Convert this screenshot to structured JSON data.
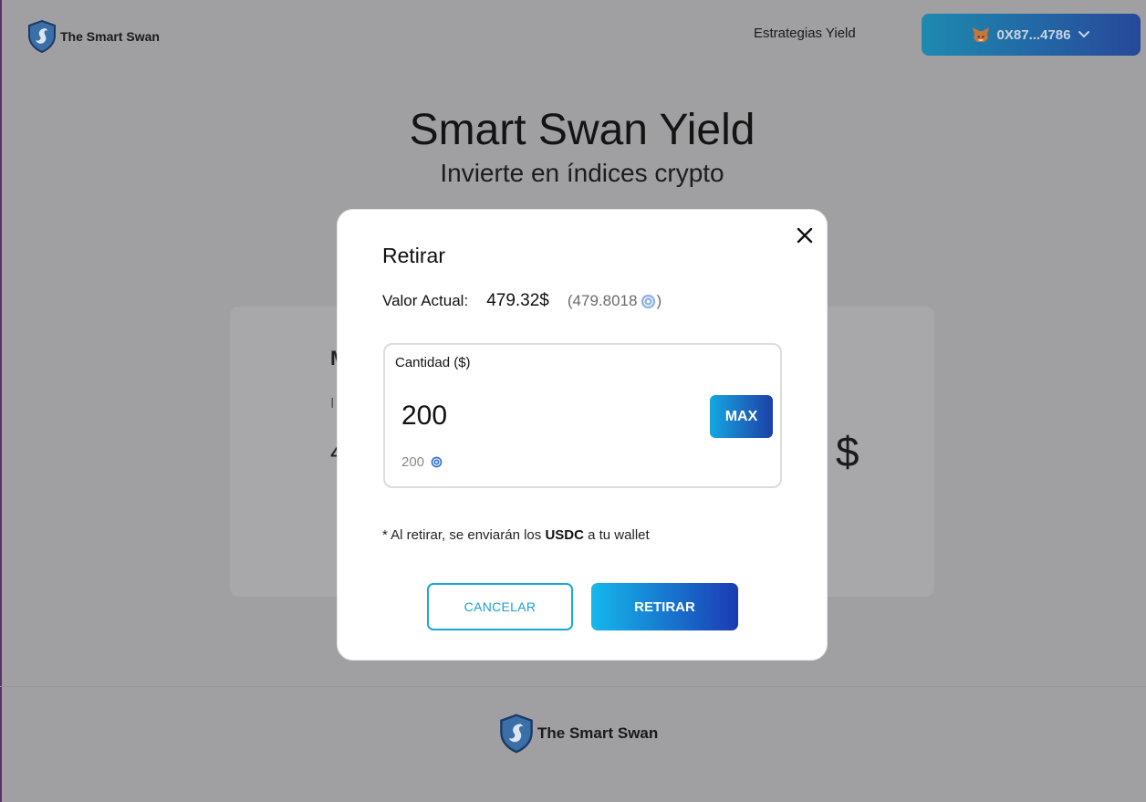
{
  "header": {
    "brand": "The Smart Swan",
    "nav_link": "Estrategias Yield",
    "wallet_address": "0X87...4786"
  },
  "hero": {
    "title": "Smart Swan Yield",
    "subtitle": "Invierte en índices crypto"
  },
  "background_card": {
    "fragment_title": "M",
    "fragment_text": "I",
    "fragment_value": "4",
    "currency_symbol": "$"
  },
  "modal": {
    "title": "Retirar",
    "current_value_label": "Valor Actual:",
    "current_value_usd": "479.32$",
    "current_value_open": "(",
    "current_value_token": "479.8018",
    "current_value_close": ")",
    "amount_label": "Cantidad ($)",
    "amount_value": "200",
    "amount_token": "200",
    "max_label": "MAX",
    "note_prefix": "* Al retirar, se enviarán los",
    "note_token": "USDC",
    "note_suffix": "a tu wallet",
    "cancel_label": "CANCELAR",
    "confirm_label": "RETIRAR"
  },
  "footer": {
    "brand": "The Smart Swan"
  },
  "colors": {
    "accent_start": "#15b8ec",
    "accent_end": "#1a3bb4",
    "overlay": "#a0a0a2"
  }
}
